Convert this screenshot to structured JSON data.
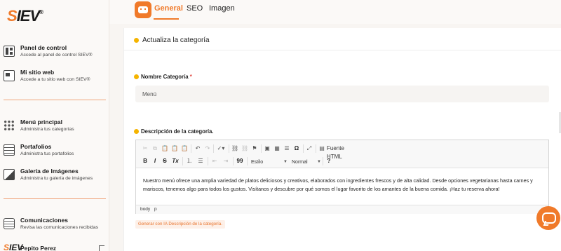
{
  "brand": {
    "logo_s": "S",
    "logo_rest": "IEV",
    "reg": "®"
  },
  "sidebar": {
    "items": [
      {
        "title": "Panel de control",
        "subtitle": "Accede al panel de control SIEV®",
        "icon": "dashboard-icon"
      },
      {
        "title": "Mi sitio web",
        "subtitle": "Accede a tu sitio web con SIEV®",
        "icon": "website-icon"
      },
      {
        "title": "Menú principal",
        "subtitle": "Administra tus categorías",
        "icon": "grid-icon"
      },
      {
        "title": "Portafolios",
        "subtitle": "Administra tus portafolios",
        "icon": "document-icon"
      },
      {
        "title": "Galería de Imágenes",
        "subtitle": "Administra tu galería de imágenes",
        "icon": "image-icon"
      },
      {
        "title": "Comunicaciones",
        "subtitle": "Revisa las comunicaciones recibidas",
        "icon": "message-icon"
      }
    ],
    "user": {
      "logo_s": "S",
      "logo_rest": "IEV",
      "name": "Pepito Perez"
    }
  },
  "tabs": [
    {
      "label": "General",
      "active": true
    },
    {
      "label": "SEO",
      "active": false
    },
    {
      "label": "Imagen",
      "active": false
    }
  ],
  "card": {
    "title": "Actualiza la categoría",
    "name_label": "Nombre Categoría",
    "name_required_mark": "*",
    "name_value": "Menú",
    "desc_label": "Descripción de la categoría.",
    "description": "Nuestro menú ofrece una amplia variedad de platos deliciosos y creativos, elaborados con ingredientes frescos y de alta calidad. Desde opciones vegetarianas hasta carnes y mariscos, tenemos algo para todos los gustos. Visítanos y descubre por qué somos el lugar favorito de los amantes de la buena comida. ¡Haz tu reserva ahora!",
    "ai_button": "Generar con IA Descripción de la categoría."
  },
  "editor": {
    "source_label": "Fuente HTML",
    "style_select": "Estilo",
    "format_select": "Normal",
    "bold": "B",
    "italic": "I",
    "strike": "S",
    "remove_format": "Tx",
    "quote": "99",
    "help": "?",
    "omega": "Ω",
    "path": [
      "body",
      "p"
    ]
  },
  "colors": {
    "accent": "#f07a2a",
    "info": "#f5b400",
    "required": "#e0403a"
  }
}
